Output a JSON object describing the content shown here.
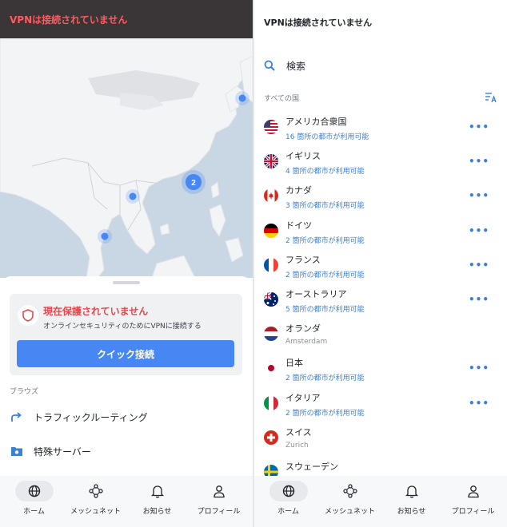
{
  "left": {
    "status_bar_text": "VPNは接続されていません",
    "map": {
      "cluster_count": "2"
    },
    "status_card": {
      "title": "現在保護されていません",
      "subtitle": "オンラインセキュリティのためにVPNに接続する",
      "quick_connect_label": "クイック接続"
    },
    "browse": {
      "section_label": "ブラウズ",
      "items": [
        {
          "label": "トラフィックルーティング",
          "icon": "route-arrow-icon"
        },
        {
          "label": "特殊サーバー",
          "icon": "folder-server-icon"
        }
      ]
    }
  },
  "right": {
    "title": "VPNは接続されていません",
    "search_label": "検索",
    "all_countries_label": "すべての国",
    "countries": [
      {
        "name": "アメリカ合衆国",
        "sub": "16 箇所の都市が利用可能",
        "flag": "us"
      },
      {
        "name": "イギリス",
        "sub": "4 箇所の都市が利用可能",
        "flag": "gb"
      },
      {
        "name": "カナダ",
        "sub": "3 箇所の都市が利用可能",
        "flag": "ca"
      },
      {
        "name": "ドイツ",
        "sub": "2 箇所の都市が利用可能",
        "flag": "de"
      },
      {
        "name": "フランス",
        "sub": "2 箇所の都市が利用可能",
        "flag": "fr"
      },
      {
        "name": "オーストラリア",
        "sub": "5 箇所の都市が利用可能",
        "flag": "au"
      },
      {
        "name": "オランダ",
        "sub": "Amsterdam",
        "flag": "nl"
      },
      {
        "name": "日本",
        "sub": "2 箇所の都市が利用可能",
        "flag": "jp"
      },
      {
        "name": "イタリア",
        "sub": "2 箇所の都市が利用可能",
        "flag": "it"
      },
      {
        "name": "スイス",
        "sub": "Zurich",
        "flag": "ch"
      },
      {
        "name": "スウェーデン",
        "sub": "",
        "flag": "se"
      }
    ],
    "more_label": "•••"
  },
  "bottom_nav": [
    {
      "label": "ホーム",
      "icon": "globe-icon",
      "active": true
    },
    {
      "label": "メッシュネット",
      "icon": "meshnet-icon",
      "active": false
    },
    {
      "label": "お知らせ",
      "icon": "bell-icon",
      "active": false
    },
    {
      "label": "プロフィール",
      "icon": "profile-icon",
      "active": false
    }
  ],
  "colors": {
    "accent": "#4687f4",
    "danger": "#e5484d",
    "link": "#3e7fd6",
    "map_water": "#c9d6e3",
    "map_land": "#f3f4f6"
  }
}
